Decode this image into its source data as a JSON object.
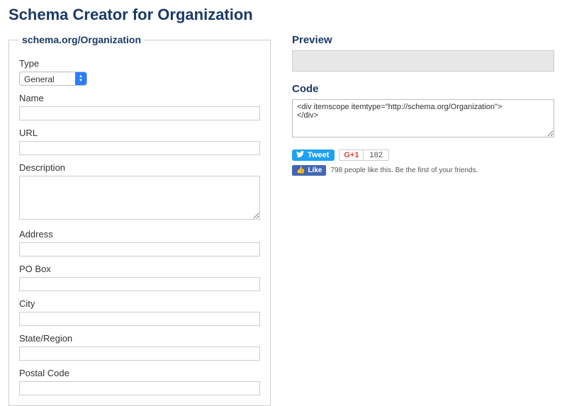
{
  "page_title": "Schema Creator for Organization",
  "form": {
    "legend": "schema.org/Organization",
    "type_label": "Type",
    "type_value": "General",
    "name_label": "Name",
    "url_label": "URL",
    "description_label": "Description",
    "address_label": "Address",
    "pobox_label": "PO Box",
    "city_label": "City",
    "state_label": "State/Region",
    "postal_label": "Postal Code"
  },
  "preview": {
    "heading": "Preview"
  },
  "code": {
    "heading": "Code",
    "content": "<div itemscope itemtype=\"http://schema.org/Organization\">\n</div>"
  },
  "social": {
    "tweet_label": "Tweet",
    "gplus_label": "G+1",
    "gplus_count": "182",
    "fb_like_label": "Like",
    "fb_text": "798 people like this. Be the first of your friends."
  }
}
